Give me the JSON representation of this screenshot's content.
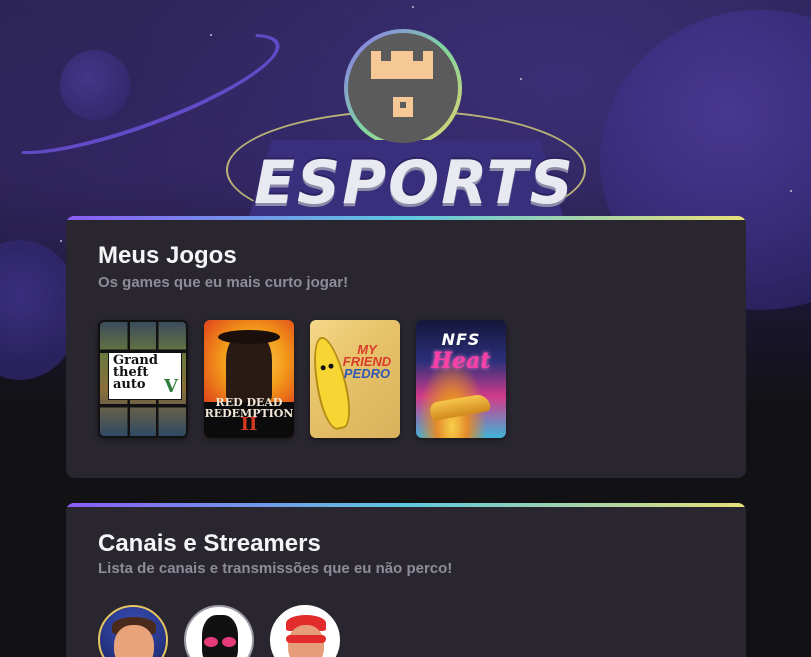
{
  "logo": {
    "text": "ESPORTS"
  },
  "games_section": {
    "title": "Meus Jogos",
    "subtitle": "Os games que eu mais curto jogar!",
    "games": [
      {
        "name": "Grand Theft Auto V",
        "cover_text": "Grand theft auto",
        "cover_badge": "V"
      },
      {
        "name": "Red Dead Redemption II",
        "cover_text": "RED DEAD REDEMPTION",
        "cover_badge": "II"
      },
      {
        "name": "My Friend Pedro",
        "cover_text_1": "MY",
        "cover_text_2": "FRIEND",
        "cover_text_3": "PEDRO"
      },
      {
        "name": "Need for Speed Heat",
        "cover_text": "NFS",
        "cover_badge": "Heat"
      }
    ]
  },
  "streamers_section": {
    "title": "Canais e Streamers",
    "subtitle": "Lista de canais e transmissões que eu não perco!",
    "streamers": [
      {
        "avatar": "streamer-avatar-1"
      },
      {
        "avatar": "streamer-avatar-2"
      },
      {
        "avatar": "streamer-avatar-3"
      }
    ]
  },
  "colors": {
    "background": "#121214",
    "card": "#29262f",
    "title": "#f5f5f7",
    "subtitle": "#8f8c99",
    "accent_gradient": [
      "#8a5cf6",
      "#5ec8e0",
      "#e8e077"
    ]
  }
}
